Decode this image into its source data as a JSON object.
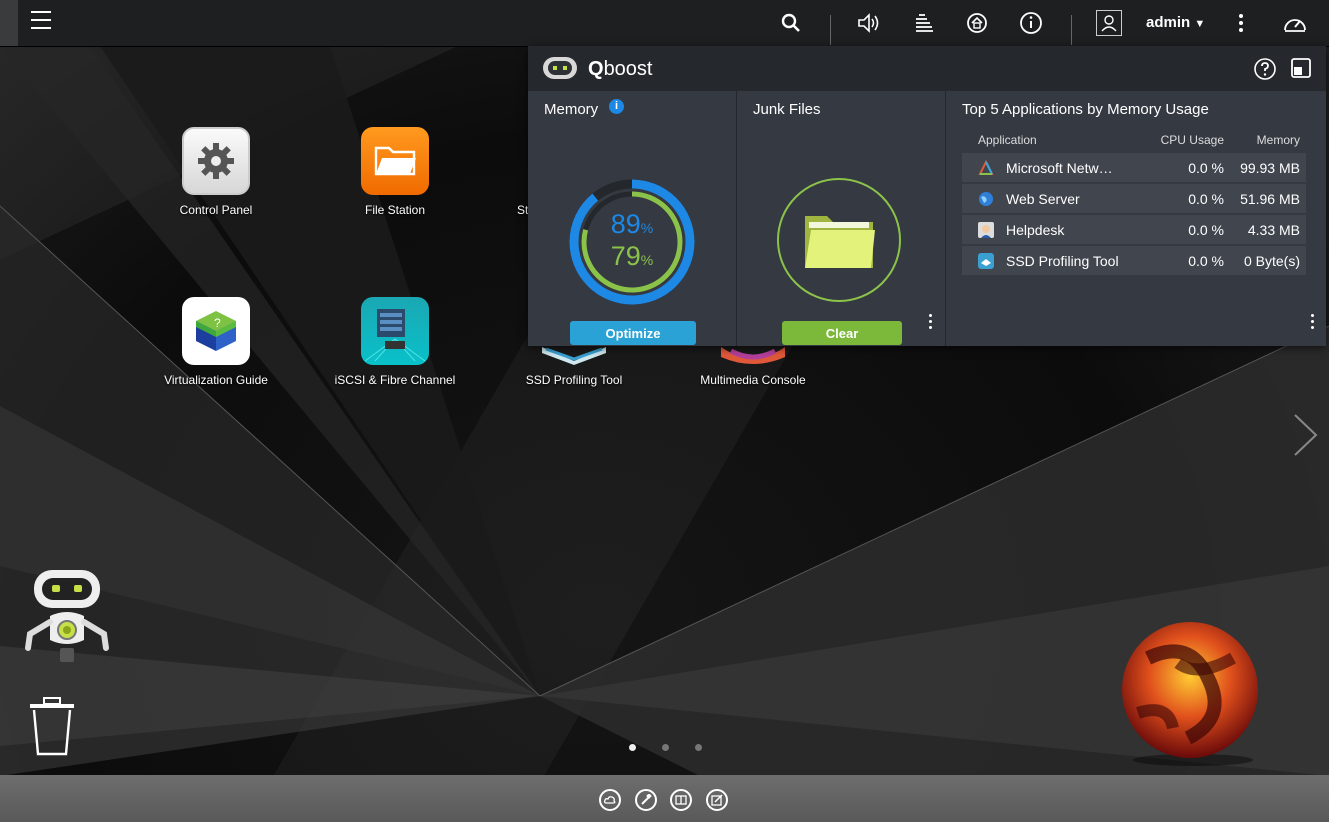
{
  "topbar": {
    "user": "admin"
  },
  "desktop": {
    "apps": [
      {
        "label": "Control Panel"
      },
      {
        "label": "File Station"
      },
      {
        "label": "St"
      },
      {
        "label": "Virtualization Guide"
      },
      {
        "label": "iSCSI & Fibre Channel"
      },
      {
        "label": "SSD Profiling Tool"
      },
      {
        "label": "Multimedia Console"
      }
    ]
  },
  "qboost": {
    "title_bold": "Q",
    "title_rest": "boost",
    "memory": {
      "title": "Memory",
      "outer_percent": 89,
      "inner_percent": 79,
      "outer_label": "89",
      "inner_label": "79",
      "unit": "%",
      "button": "Optimize"
    },
    "junk": {
      "title": "Junk Files",
      "button": "Clear"
    },
    "top_apps": {
      "title": "Top 5 Applications by Memory Usage",
      "columns": [
        "Application",
        "CPU Usage",
        "Memory"
      ],
      "rows": [
        {
          "name": "Microsoft Netw…",
          "cpu": "0.0 %",
          "memory": "99.93 MB",
          "icon": "triangle-icon"
        },
        {
          "name": "Web Server",
          "cpu": "0.0 %",
          "memory": "51.96 MB",
          "icon": "globe-icon"
        },
        {
          "name": "Helpdesk",
          "cpu": "0.0 %",
          "memory": "4.33 MB",
          "icon": "helpdesk-icon"
        },
        {
          "name": "SSD Profiling Tool",
          "cpu": "0.0 %",
          "memory": "0 Byte(s)",
          "icon": "ssd-icon"
        }
      ]
    }
  },
  "colors": {
    "memory_blue": "#1e88e5",
    "memory_green": "#8bc34a",
    "optimize_btn": "#2aa2d6",
    "clear_btn": "#7cb83a"
  },
  "pager": {
    "count": 3,
    "active": 0
  }
}
